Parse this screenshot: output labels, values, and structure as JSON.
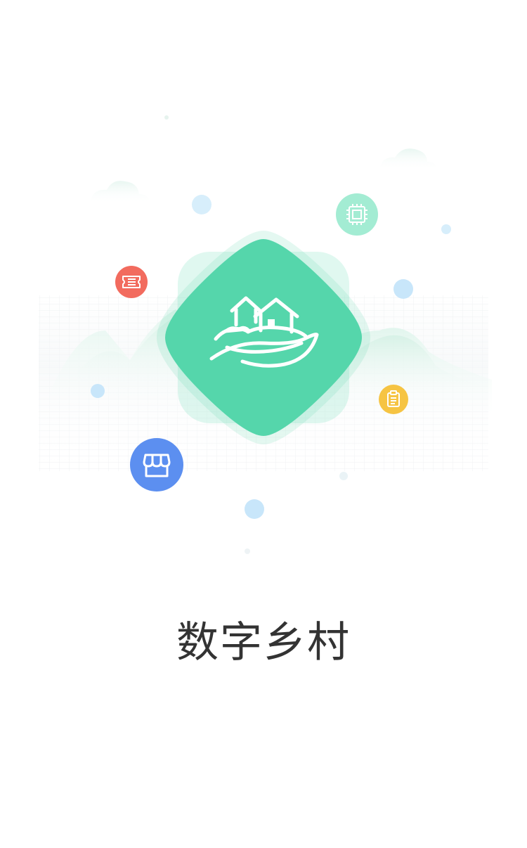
{
  "app": {
    "title": "数字乡村"
  },
  "colors": {
    "brand_green": "#55d6ab",
    "title_text": "#333333",
    "badge_red": "#f26b5e",
    "badge_mint": "#a3ecd3",
    "badge_yellow": "#f6c443",
    "badge_blue": "#5c8ff0",
    "bubble_blue": "#cfeafb"
  },
  "icons": {
    "logo": "village-houses-icon",
    "ticket": "ticket-icon",
    "chip": "chip-icon",
    "clipboard": "clipboard-icon",
    "store": "store-icon"
  }
}
